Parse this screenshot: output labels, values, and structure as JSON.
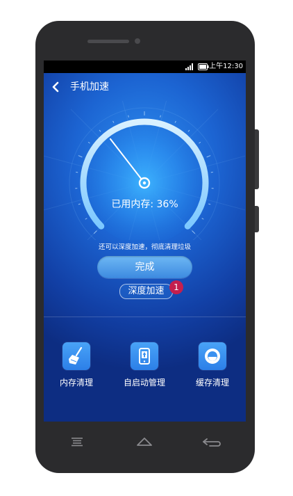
{
  "statusbar": {
    "time": "上午12:30",
    "signal_icon": "signal-bars-icon",
    "battery_icon": "battery-icon"
  },
  "header": {
    "back_icon": "back-arrow-icon",
    "title": "手机加速"
  },
  "gauge": {
    "memory_used_label": "已用内存: 36%",
    "memory_used_percent": 36
  },
  "actions": {
    "hint": "还可以深度加速，彻底清理垃圾",
    "done_label": "完成",
    "deep_label": "深度加速",
    "badge_count": "1"
  },
  "tools": [
    {
      "label": "内存清理",
      "icon": "broom-icon"
    },
    {
      "label": "自启动管理",
      "icon": "phone-startup-icon"
    },
    {
      "label": "缓存清理",
      "icon": "cache-disc-icon"
    }
  ],
  "navbar": {
    "menu_icon": "menu-icon",
    "home_icon": "home-icon",
    "back_icon": "back-icon"
  },
  "colors": {
    "screen_top": "#2d8ff0",
    "screen_bottom": "#0d2d82",
    "badge": "#c41f4e",
    "tile": "#3a91f0"
  }
}
